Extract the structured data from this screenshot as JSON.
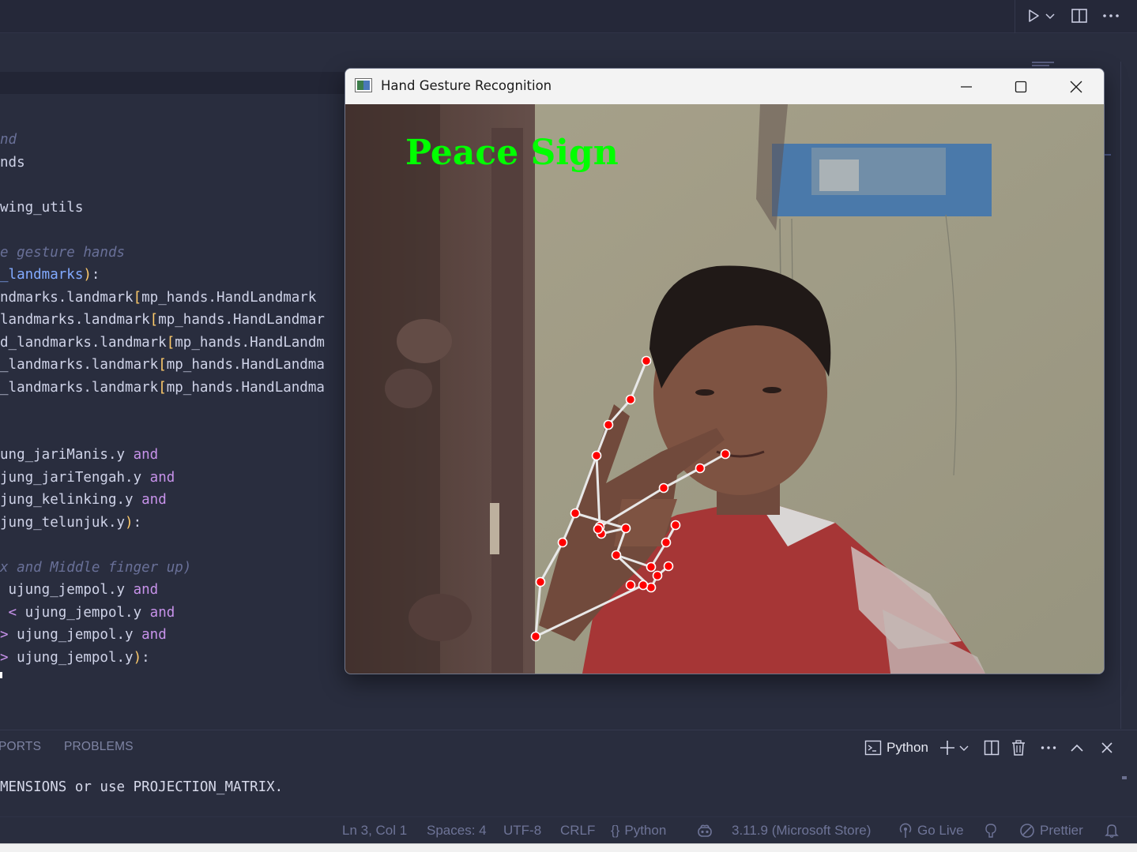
{
  "topbar": {
    "icons": [
      "run-icon",
      "chevron-down-icon",
      "split-editor-icon",
      "more-actions-icon"
    ]
  },
  "editor": {
    "lines": [
      {
        "parts": [
          {
            "t": "nd",
            "c": "cmt"
          }
        ]
      },
      {
        "parts": [
          {
            "t": "nds",
            "c": ""
          }
        ]
      },
      {
        "parts": [
          {
            "t": "",
            "c": ""
          }
        ]
      },
      {
        "parts": [
          {
            "t": "wing_utils",
            "c": ""
          }
        ]
      },
      {
        "parts": [
          {
            "t": "",
            "c": ""
          }
        ]
      },
      {
        "parts": [
          {
            "t": "e gesture hands",
            "c": "cmt"
          }
        ]
      },
      {
        "parts": [
          {
            "t": "_landmarks",
            "c": "prm"
          },
          {
            "t": ")",
            "c": "br"
          },
          {
            "t": ":",
            "c": ""
          }
        ]
      },
      {
        "parts": [
          {
            "t": "ndmarks.landmark",
            "c": ""
          },
          {
            "t": "[",
            "c": "br"
          },
          {
            "t": "mp_hands.HandLandmark",
            "c": ""
          }
        ]
      },
      {
        "parts": [
          {
            "t": "landmarks.landmark",
            "c": ""
          },
          {
            "t": "[",
            "c": "br"
          },
          {
            "t": "mp_hands.HandLandmar",
            "c": ""
          }
        ]
      },
      {
        "parts": [
          {
            "t": "d_landmarks.landmark",
            "c": ""
          },
          {
            "t": "[",
            "c": "br"
          },
          {
            "t": "mp_hands.HandLandm",
            "c": ""
          }
        ]
      },
      {
        "parts": [
          {
            "t": "_landmarks.landmark",
            "c": ""
          },
          {
            "t": "[",
            "c": "br"
          },
          {
            "t": "mp_hands.HandLandma",
            "c": ""
          }
        ]
      },
      {
        "parts": [
          {
            "t": "_landmarks.landmark",
            "c": ""
          },
          {
            "t": "[",
            "c": "br"
          },
          {
            "t": "mp_hands.HandLandma",
            "c": ""
          }
        ]
      },
      {
        "parts": [
          {
            "t": "",
            "c": ""
          }
        ]
      },
      {
        "parts": [
          {
            "t": "",
            "c": ""
          }
        ]
      },
      {
        "parts": [
          {
            "t": "ung_jariManis.y ",
            "c": ""
          },
          {
            "t": "and",
            "c": "kw"
          }
        ]
      },
      {
        "parts": [
          {
            "t": "jung_jariTengah.y ",
            "c": ""
          },
          {
            "t": "and",
            "c": "kw"
          }
        ]
      },
      {
        "parts": [
          {
            "t": "jung_kelinking.y ",
            "c": ""
          },
          {
            "t": "and",
            "c": "kw"
          }
        ]
      },
      {
        "parts": [
          {
            "t": "jung_telunjuk.y",
            "c": ""
          },
          {
            "t": ")",
            "c": "br"
          },
          {
            "t": ":",
            "c": ""
          }
        ]
      },
      {
        "parts": [
          {
            "t": "",
            "c": ""
          }
        ]
      },
      {
        "parts": [
          {
            "t": "x and Middle finger up)",
            "c": "cmt"
          }
        ]
      },
      {
        "parts": [
          {
            "t": " ujung_jempol.y ",
            "c": ""
          },
          {
            "t": "and",
            "c": "kw"
          }
        ]
      },
      {
        "parts": [
          {
            "t": " < ",
            "c": "kw"
          },
          {
            "t": "ujung_jempol.y ",
            "c": ""
          },
          {
            "t": "and",
            "c": "kw"
          }
        ]
      },
      {
        "parts": [
          {
            "t": "> ",
            "c": "kw"
          },
          {
            "t": "ujung_jempol.y ",
            "c": ""
          },
          {
            "t": "and",
            "c": "kw"
          }
        ]
      },
      {
        "parts": [
          {
            "t": "> ",
            "c": "kw"
          },
          {
            "t": "ujung_jempol.y",
            "c": ""
          },
          {
            "t": ")",
            "c": "br"
          },
          {
            "t": ":",
            "c": ""
          }
        ]
      }
    ]
  },
  "panel": {
    "tabs": [
      "PORTS",
      "PROBLEMS"
    ],
    "terminal_profile": "Python",
    "terminal_output": "MENSIONS or use PROJECTION_MATRIX."
  },
  "statusbar": {
    "position": "Ln 3, Col 1",
    "spaces": "Spaces: 4",
    "encoding": "UTF-8",
    "eol": "CRLF",
    "language": "Python",
    "interpreter": "3.11.9 (Microsoft Store)",
    "go_live": "Go Live",
    "prettier": "Prettier"
  },
  "window": {
    "title": "Hand Gesture Recognition",
    "gesture_label": "Peace Sign",
    "gesture_color": "#00ff00",
    "landmark_color": "#ff0000",
    "connection_color": "#e8e8e8"
  },
  "colors": {
    "editor_bg": "#292d3e",
    "accent": "#82aaff"
  }
}
